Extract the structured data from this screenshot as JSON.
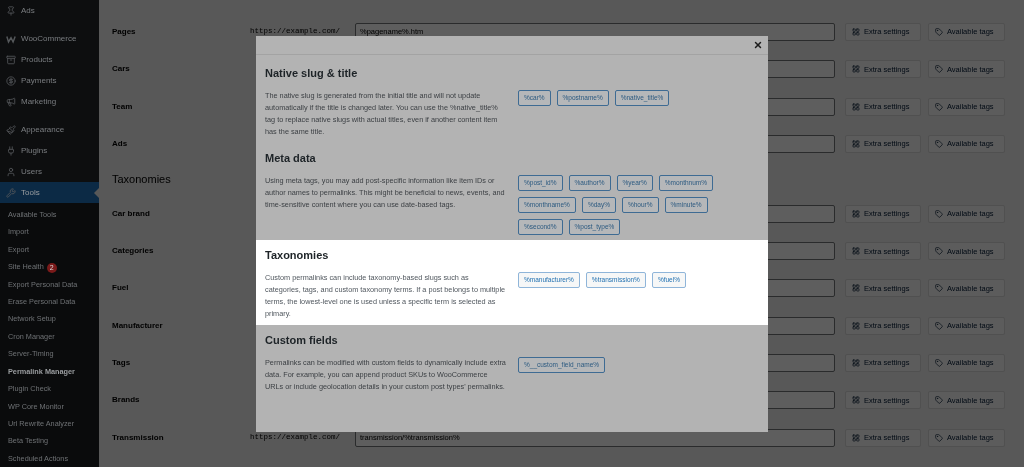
{
  "sidebar": {
    "groups": [
      [
        {
          "label": "Ads",
          "selected": false
        }
      ],
      [
        {
          "label": "WooCommerce",
          "selected": false
        },
        {
          "label": "Products",
          "selected": false
        },
        {
          "label": "Payments",
          "selected": false
        },
        {
          "label": "Marketing",
          "selected": false
        }
      ],
      [
        {
          "label": "Appearance",
          "selected": false
        },
        {
          "label": "Plugins",
          "selected": false
        },
        {
          "label": "Users",
          "selected": false
        },
        {
          "label": "Tools",
          "selected": true
        }
      ]
    ],
    "submenu": [
      {
        "label": "Available Tools",
        "selected": false
      },
      {
        "label": "Import",
        "selected": false
      },
      {
        "label": "Export",
        "selected": false
      },
      {
        "label": "Site Health",
        "badge": "2",
        "selected": false
      },
      {
        "label": "Export Personal Data",
        "selected": false
      },
      {
        "label": "Erase Personal Data",
        "selected": false
      },
      {
        "label": "Network Setup",
        "selected": false
      },
      {
        "label": "Cron Manager",
        "selected": false
      },
      {
        "label": "Server-Timing",
        "selected": false
      },
      {
        "label": "Permalink Manager",
        "selected": true
      },
      {
        "label": "Plugin Check",
        "selected": false
      },
      {
        "label": "WP Core Monitor",
        "selected": false
      },
      {
        "label": "Url Rewrite Analyzer",
        "selected": false
      },
      {
        "label": "Beta Testing",
        "selected": false
      },
      {
        "label": "Scheduled Actions",
        "selected": false
      }
    ]
  },
  "content": {
    "rows": [
      {
        "kind": "row",
        "label": "Pages",
        "prefix": "https://example.com/",
        "value": "%pagename%.htm",
        "buttons": [
          "Extra settings",
          "Available tags"
        ]
      },
      {
        "kind": "row",
        "label": "Cars",
        "buttons": [
          "Extra settings",
          "Available tags"
        ]
      },
      {
        "kind": "row",
        "label": "Team",
        "buttons": [
          "Extra settings",
          "Available tags"
        ]
      },
      {
        "kind": "row",
        "label": "Ads",
        "buttons": [
          "Extra settings",
          "Available tags"
        ]
      },
      {
        "kind": "heading",
        "label": "Taxonomies"
      },
      {
        "kind": "row",
        "label": "Car brand",
        "buttons": [
          "Extra settings",
          "Available tags"
        ]
      },
      {
        "kind": "row",
        "label": "Categories",
        "buttons": [
          "Extra settings",
          "Available tags"
        ]
      },
      {
        "kind": "row",
        "label": "Fuel",
        "buttons": [
          "Extra settings",
          "Available tags"
        ]
      },
      {
        "kind": "row",
        "label": "Manufacturer",
        "buttons": [
          "Extra settings",
          "Available tags"
        ]
      },
      {
        "kind": "row",
        "label": "Tags",
        "buttons": [
          "Extra settings",
          "Available tags"
        ]
      },
      {
        "kind": "row",
        "label": "Brands",
        "buttons": [
          "Extra settings",
          "Available tags"
        ]
      },
      {
        "kind": "row",
        "label": "Transmission",
        "prefix": "https://example.com/",
        "value": "transmission/%transmission%",
        "buttons": [
          "Extra settings",
          "Available tags"
        ]
      }
    ]
  },
  "modal": {
    "sections": [
      {
        "title": "Native slug & title",
        "highlighted": false,
        "text": "The native slug is generated from the initial title and will not update automatically if the title is changed later. You can use the %native_title% tag to replace native slugs with actual titles, even if another content item has the same title.",
        "tags": [
          "%car%",
          "%postname%",
          "%native_title%"
        ]
      },
      {
        "title": "Meta data",
        "highlighted": false,
        "text": "Using meta tags, you may add post-specific information like item IDs or author names to permalinks. This might be beneficial to news, events, and time-sensitive content where you can use date-based tags.",
        "tags": [
          "%post_id%",
          "%author%",
          "%year%",
          "%monthnum%",
          "%monthname%",
          "%day%",
          "%hour%",
          "%minute%",
          "%second%",
          "%post_type%"
        ]
      },
      {
        "title": "Taxonomies",
        "highlighted": true,
        "text": "Custom permalinks can include taxonomy-based slugs such as categories, tags, and custom taxonomy terms. If a post belongs to multiple terms, the lowest-level one is used unless a specific term is selected as primary.",
        "tags": [
          "%manufacturer%",
          "%transmission%",
          "%fuel%"
        ]
      },
      {
        "title": "Custom fields",
        "highlighted": false,
        "text": "Permalinks can be modified with custom fields to dynamically include extra data. For example, you can append product SKUs to WooCommerce URLs or include geolocation details in your custom post types' permalinks.",
        "tags": [
          "%__custom_field_name%"
        ]
      }
    ]
  }
}
